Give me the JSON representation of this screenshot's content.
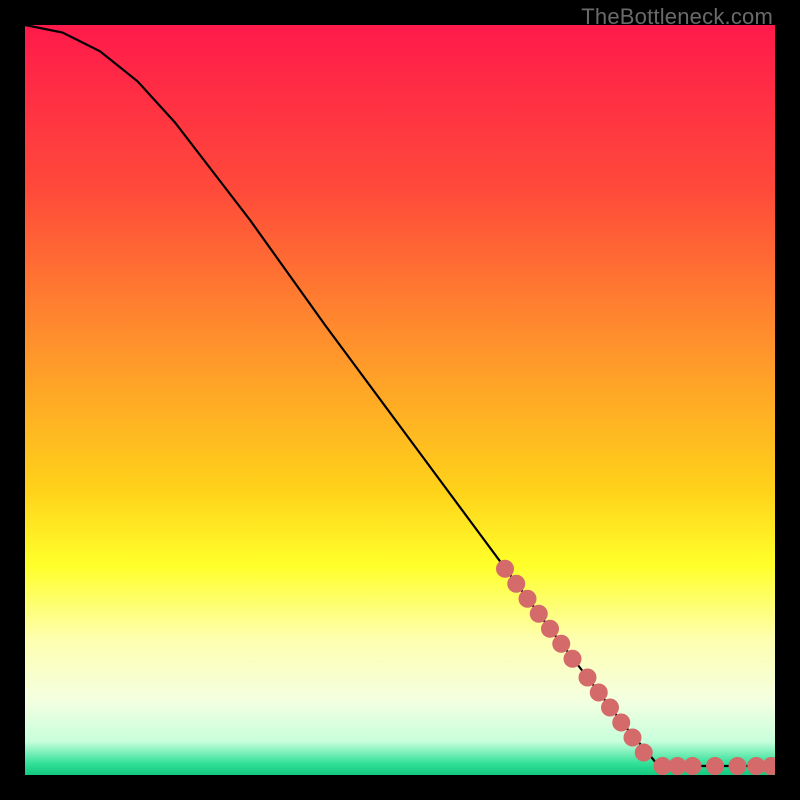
{
  "watermark": "TheBottleneck.com",
  "chart_data": {
    "type": "line",
    "title": "",
    "xlabel": "",
    "ylabel": "",
    "xlim": [
      0,
      100
    ],
    "ylim": [
      0,
      100
    ],
    "grid": false,
    "legend": false,
    "gradient_stops": [
      {
        "offset": 0.0,
        "color": "#ff1a4b"
      },
      {
        "offset": 0.22,
        "color": "#ff4a3a"
      },
      {
        "offset": 0.45,
        "color": "#ff9a2a"
      },
      {
        "offset": 0.62,
        "color": "#ffd21a"
      },
      {
        "offset": 0.72,
        "color": "#ffff2a"
      },
      {
        "offset": 0.82,
        "color": "#feffb0"
      },
      {
        "offset": 0.9,
        "color": "#f4ffe0"
      },
      {
        "offset": 0.955,
        "color": "#c8ffdc"
      },
      {
        "offset": 0.985,
        "color": "#30e097"
      },
      {
        "offset": 1.0,
        "color": "#12c97f"
      }
    ],
    "series": [
      {
        "name": "curve",
        "color": "#000000",
        "points": [
          {
            "x": 0,
            "y": 100
          },
          {
            "x": 5,
            "y": 99
          },
          {
            "x": 10,
            "y": 96.5
          },
          {
            "x": 15,
            "y": 92.5
          },
          {
            "x": 20,
            "y": 87
          },
          {
            "x": 30,
            "y": 74
          },
          {
            "x": 40,
            "y": 60
          },
          {
            "x": 50,
            "y": 46.5
          },
          {
            "x": 60,
            "y": 33
          },
          {
            "x": 70,
            "y": 19.5
          },
          {
            "x": 80,
            "y": 6.5
          },
          {
            "x": 84,
            "y": 1.8
          },
          {
            "x": 86,
            "y": 1.2
          },
          {
            "x": 100,
            "y": 1.2
          }
        ]
      },
      {
        "name": "dots",
        "color": "#d46a6a",
        "points": [
          {
            "x": 64,
            "y": 27.5
          },
          {
            "x": 65.5,
            "y": 25.5
          },
          {
            "x": 67,
            "y": 23.5
          },
          {
            "x": 68.5,
            "y": 21.5
          },
          {
            "x": 70,
            "y": 19.5
          },
          {
            "x": 71.5,
            "y": 17.5
          },
          {
            "x": 73,
            "y": 15.5
          },
          {
            "x": 75,
            "y": 13
          },
          {
            "x": 76.5,
            "y": 11
          },
          {
            "x": 78,
            "y": 9
          },
          {
            "x": 79.5,
            "y": 7
          },
          {
            "x": 81,
            "y": 5
          },
          {
            "x": 82.5,
            "y": 3
          },
          {
            "x": 85,
            "y": 1.2
          },
          {
            "x": 87,
            "y": 1.2
          },
          {
            "x": 89,
            "y": 1.2
          },
          {
            "x": 92,
            "y": 1.2
          },
          {
            "x": 95,
            "y": 1.2
          },
          {
            "x": 97.5,
            "y": 1.2
          },
          {
            "x": 99.5,
            "y": 1.2
          }
        ]
      }
    ]
  }
}
